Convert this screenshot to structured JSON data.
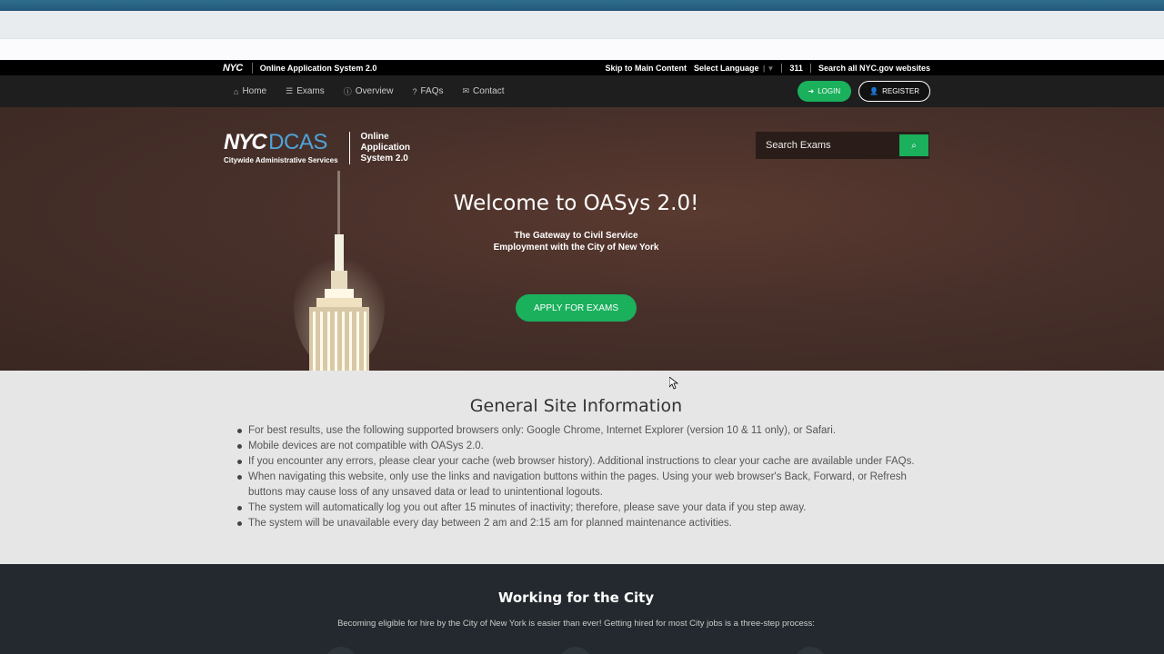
{
  "util_bar": {
    "logo": "NYC",
    "title": "Online Application System 2.0",
    "skip": "Skip to Main Content",
    "language": "Select Language",
    "num311": "311",
    "search_all": "Search all NYC.gov websites"
  },
  "nav": {
    "items": [
      {
        "label": "Home",
        "icon": "home-icon"
      },
      {
        "label": "Exams",
        "icon": "list-icon"
      },
      {
        "label": "Overview",
        "icon": "info-icon"
      },
      {
        "label": "FAQs",
        "icon": "question-icon"
      },
      {
        "label": "Contact",
        "icon": "envelope-icon"
      }
    ],
    "login": "LOGIN",
    "register": "REGISTER"
  },
  "hero": {
    "brand_nyc": "NYC",
    "brand_dcas": "DCAS",
    "brand_sub": "Citywide Administrative Services",
    "brand_oas_1": "Online",
    "brand_oas_2": "Application",
    "brand_oas_3": "System 2.0",
    "search_placeholder": "Search Exams",
    "title": "Welcome to OASys 2.0!",
    "subtitle_1": "The Gateway to Civil Service",
    "subtitle_2": "Employment with the City of New York",
    "apply": "APPLY FOR EXAMS"
  },
  "info": {
    "title": "General Site Information",
    "items": [
      "For best results, use the following supported browsers only: Google Chrome, Internet Explorer (version 10 & 11 only), or Safari.",
      "Mobile devices are not compatible with OASys 2.0.",
      "If you encounter any errors, please clear your cache (web browser history). Additional instructions to clear your cache are available under FAQs.",
      "When navigating this website, only use the links and navigation buttons within the pages. Using your web browser's Back, Forward, or Refresh buttons may cause loss of any unsaved data or lead to unintentional logouts.",
      "The system will automatically log you out after 15 minutes of inactivity; therefore, please save your data if you step away.",
      "The system will be unavailable every day between 2 am and 2:15 am for planned maintenance activities."
    ]
  },
  "working": {
    "title": "Working for the City",
    "subtitle": "Becoming eligible for hire by the City of New York is easier than ever! Getting hired for most City jobs is a three-step process:"
  },
  "colors": {
    "accent_green": "#1ab05c",
    "dcas_blue": "#4fa3d8",
    "nav_dark": "#1e1e1e",
    "footer_dark": "#23292e"
  }
}
